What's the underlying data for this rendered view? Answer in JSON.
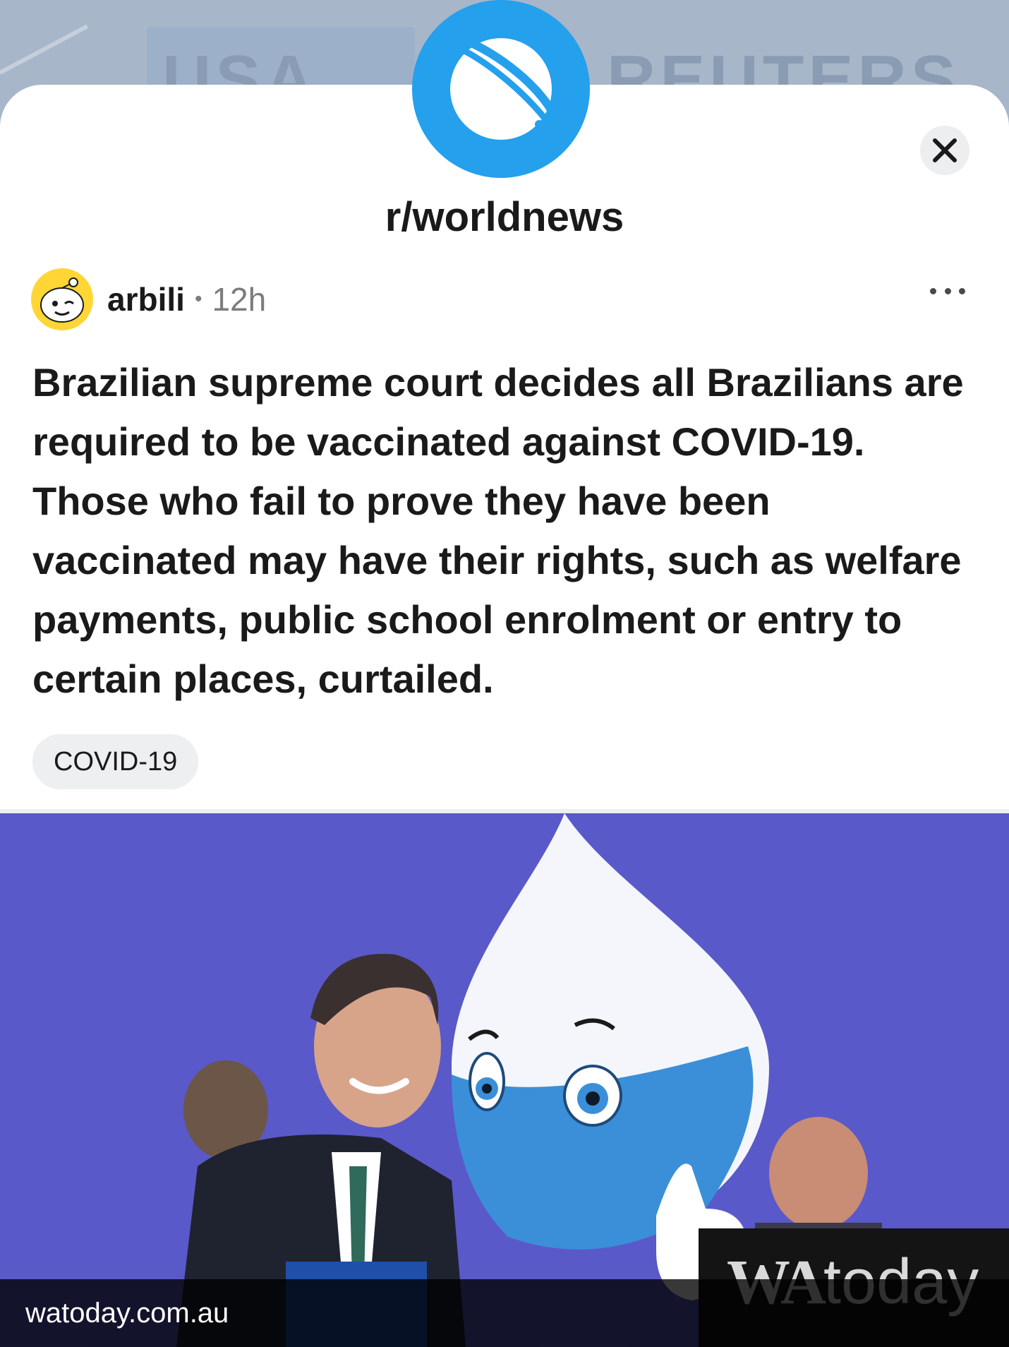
{
  "backdrop": {
    "left_text": "USA",
    "right_text": "REUTERS"
  },
  "header": {
    "subreddit": "r/worldnews",
    "close_icon": "close-icon",
    "subreddit_icon": "planet-icon"
  },
  "post": {
    "author": "arbili",
    "separator": "•",
    "age": "12h",
    "avatar_icon": "snoo-avatar",
    "title": "Brazilian supreme court decides all Brazilians are required to be vaccinated against COVID-19. Those who fail to prove they have been vaccinated may have their rights, such as welfare payments, public school enrolment or entry to certain places, curtailed.",
    "flair": "COVID-19",
    "more_icon": "more-options-icon"
  },
  "link_preview": {
    "domain": "watoday.com.au",
    "logo_bold": "WA",
    "logo_light": "today"
  },
  "colors": {
    "accent": "#24a0ed",
    "text": "#1a1a1b",
    "muted": "#7c7c7c",
    "flair_bg": "#edeff1"
  }
}
